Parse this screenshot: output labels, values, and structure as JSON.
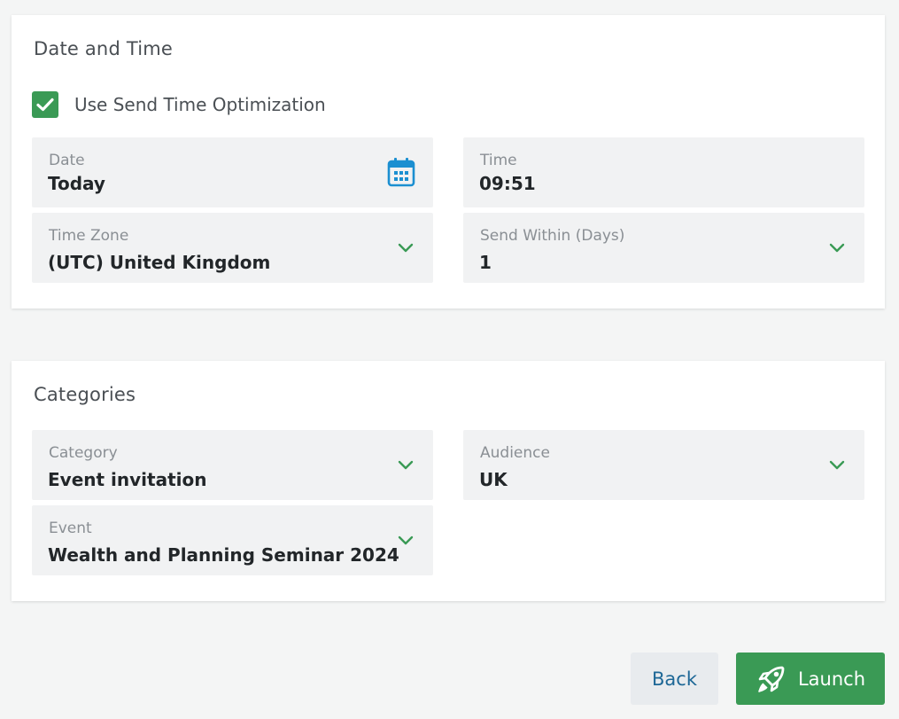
{
  "datetime": {
    "title": "Date and Time",
    "sto_label": "Use Send Time Optimization",
    "sto_checked": true,
    "date": {
      "label": "Date",
      "value": "Today",
      "icon": "calendar-icon"
    },
    "time": {
      "label": "Time",
      "value": "09:51"
    },
    "timezone": {
      "label": "Time Zone",
      "value": "(UTC) United Kingdom"
    },
    "send_within": {
      "label": "Send Within (Days)",
      "value": "1"
    }
  },
  "categories": {
    "title": "Categories",
    "category": {
      "label": "Category",
      "value": "Event invitation"
    },
    "audience": {
      "label": "Audience",
      "value": "UK"
    },
    "event": {
      "label": "Event",
      "value": "Wealth and Planning Seminar 2024"
    }
  },
  "actions": {
    "back_label": "Back",
    "launch_label": "Launch",
    "launch_icon": "rocket-icon"
  },
  "colors": {
    "accent_green": "#3a9a55",
    "calendar_blue": "#1b8fd1",
    "back_text": "#1d6796"
  }
}
